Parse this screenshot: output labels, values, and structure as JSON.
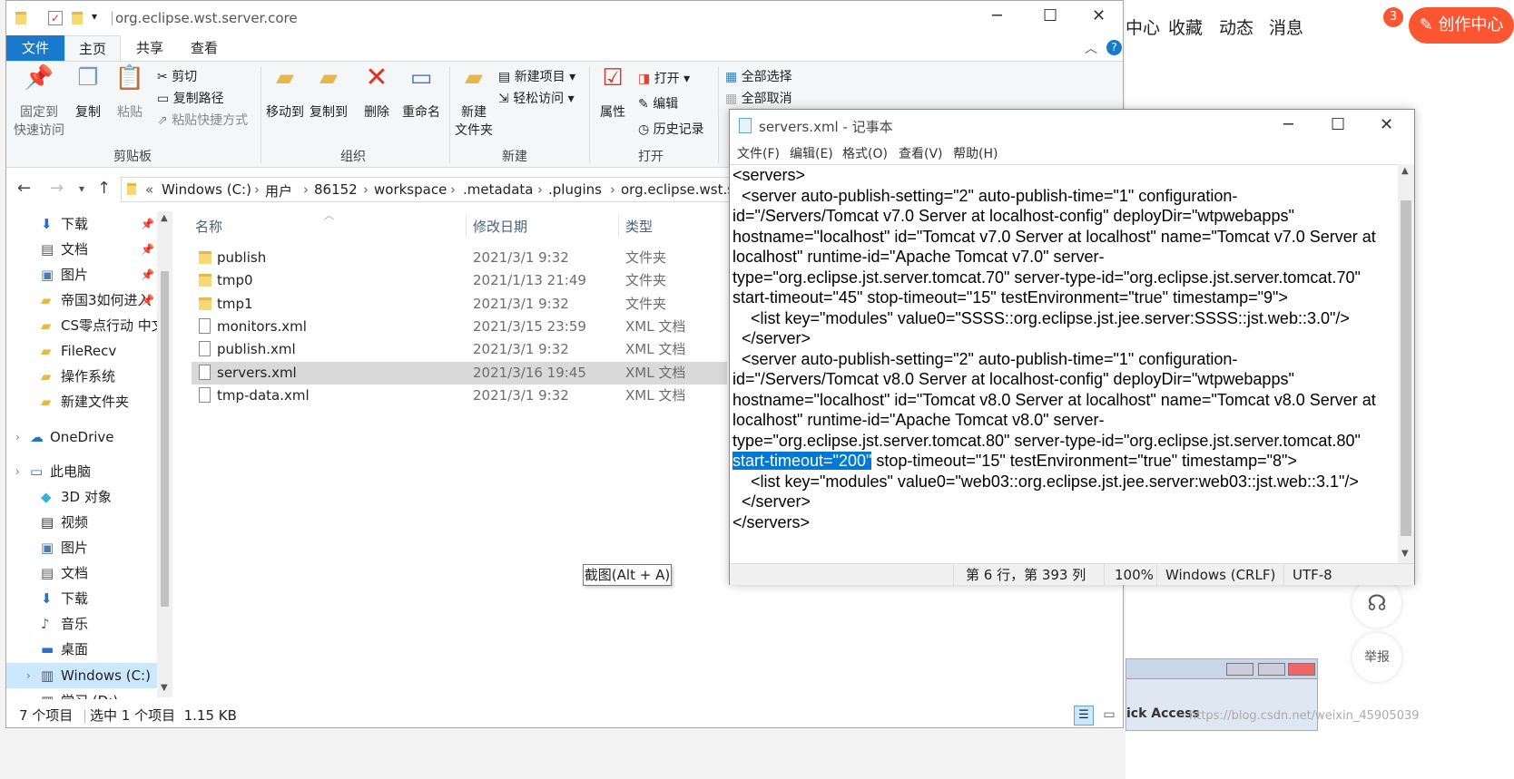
{
  "web": {
    "nav_links": [
      "中心",
      "收藏",
      "动态",
      "消息"
    ],
    "badge": "3",
    "create_btn": "创作中心",
    "report": "举报",
    "watermark": "https://blog.csdn.net/weixin_45905039",
    "access_text": "ick Access"
  },
  "explorer": {
    "title": "org.eclipse.wst.server.core",
    "tabs": [
      "文件",
      "主页",
      "共享",
      "查看"
    ],
    "ribbon": {
      "pin": "固定到\n快速访问",
      "copy": "复制",
      "paste": "粘贴",
      "cut": "剪切",
      "copy_path": "复制路径",
      "paste_shortcut": "粘贴快捷方式",
      "group_clipboard": "剪贴板",
      "move_to": "移动到",
      "copy_to": "复制到",
      "delete": "删除",
      "rename": "重命名",
      "group_organize": "组织",
      "new_folder": "新建\n文件夹",
      "new_item": "新建项目",
      "easy_access": "轻松访问",
      "group_new": "新建",
      "properties": "属性",
      "open": "打开",
      "edit": "编辑",
      "history": "历史记录",
      "group_open": "打开",
      "select_all": "全部选择",
      "select_none": "全部取消"
    },
    "breadcrumb": [
      "Windows (C:)",
      "用户",
      "86152",
      "workspace",
      ".metadata",
      ".plugins",
      "org.eclipse.wst.se"
    ],
    "nav": [
      {
        "label": "下载",
        "icon": "download-icon"
      },
      {
        "label": "文档",
        "icon": "document-icon"
      },
      {
        "label": "图片",
        "icon": "picture-icon"
      },
      {
        "label": "帝国3如何进入",
        "icon": "folder-icon"
      },
      {
        "label": "CS零点行动 中文",
        "icon": "folder-icon"
      },
      {
        "label": "FileRecv",
        "icon": "folder-icon"
      },
      {
        "label": "操作系统",
        "icon": "folder-icon"
      },
      {
        "label": "新建文件夹",
        "icon": "folder-icon"
      },
      {
        "label": "OneDrive",
        "icon": "cloud-icon"
      },
      {
        "label": "此电脑",
        "icon": "computer-icon"
      },
      {
        "label": "3D 对象",
        "icon": "cube-icon"
      },
      {
        "label": "视频",
        "icon": "video-icon"
      },
      {
        "label": "图片",
        "icon": "picture-icon"
      },
      {
        "label": "文档",
        "icon": "document-icon"
      },
      {
        "label": "下载",
        "icon": "download-icon"
      },
      {
        "label": "音乐",
        "icon": "music-icon"
      },
      {
        "label": "桌面",
        "icon": "desktop-icon"
      },
      {
        "label": "Windows (C:)",
        "icon": "drive-icon"
      },
      {
        "label": "学习 (D:)",
        "icon": "drive-icon"
      }
    ],
    "columns": [
      "名称",
      "修改日期",
      "类型"
    ],
    "files": [
      {
        "name": "publish",
        "date": "2021/3/1 9:32",
        "type": "文件夹",
        "kind": "folder"
      },
      {
        "name": "tmp0",
        "date": "2021/1/13 21:49",
        "type": "文件夹",
        "kind": "folder"
      },
      {
        "name": "tmp1",
        "date": "2021/3/1 9:32",
        "type": "文件夹",
        "kind": "folder"
      },
      {
        "name": "monitors.xml",
        "date": "2021/3/15 23:59",
        "type": "XML 文档",
        "kind": "file"
      },
      {
        "name": "publish.xml",
        "date": "2021/3/1 9:32",
        "type": "XML 文档",
        "kind": "file"
      },
      {
        "name": "servers.xml",
        "date": "2021/3/16 19:45",
        "type": "XML 文档",
        "kind": "file"
      },
      {
        "name": "tmp-data.xml",
        "date": "2021/3/1 9:32",
        "type": "XML 文档",
        "kind": "file"
      }
    ],
    "selected_index": 5,
    "status": {
      "count": "7 个项目",
      "selected": "选中 1 个项目  1.15 KB"
    },
    "tooltip": "截图(Alt + A)"
  },
  "notepad": {
    "title": "servers.xml - 记事本",
    "menu": [
      "文件(F)",
      "编辑(E)",
      "格式(O)",
      "查看(V)",
      "帮助(H)"
    ],
    "lines": [
      "<servers>",
      "  <server auto-publish-setting=\"2\" auto-publish-time=\"1\" configuration-",
      "id=\"/Servers/Tomcat v7.0 Server at localhost-config\" deployDir=\"wtpwebapps\"",
      "hostname=\"localhost\" id=\"Tomcat v7.0 Server at localhost\" name=\"Tomcat v7.0 Server at",
      "localhost\" runtime-id=\"Apache Tomcat v7.0\" server-",
      "type=\"org.eclipse.jst.server.tomcat.70\" server-type-id=\"org.eclipse.jst.server.tomcat.70\"",
      "start-timeout=\"45\" stop-timeout=\"15\" testEnvironment=\"true\" timestamp=\"9\">",
      "    <list key=\"modules\" value0=\"SSSS::org.eclipse.jst.jee.server:SSSS::jst.web::3.0\"/>",
      "  </server>",
      "  <server auto-publish-setting=\"2\" auto-publish-time=\"1\" configuration-",
      "id=\"/Servers/Tomcat v8.0 Server at localhost-config\" deployDir=\"wtpwebapps\"",
      "hostname=\"localhost\" id=\"Tomcat v8.0 Server at localhost\" name=\"Tomcat v8.0 Server at",
      "localhost\" runtime-id=\"Apache Tomcat v8.0\" server-",
      "type=\"org.eclipse.jst.server.tomcat.80\" server-type-id=\"org.eclipse.jst.server.tomcat.80\"",
      "",
      "    <list key=\"modules\" value0=\"web03::org.eclipse.jst.jee.server:web03::jst.web::3.1\"/>",
      "  </server>",
      "</servers>"
    ],
    "selected_text": "start-timeout=\"200\"",
    "after_selection": " stop-timeout=\"15\" testEnvironment=\"true\" timestamp=\"8\">",
    "status": {
      "position": "第 6 行，第 393 列",
      "zoom": "100%",
      "eol": "Windows (CRLF)",
      "encoding": "UTF-8"
    }
  },
  "colors": {
    "accent": "#0078d7",
    "csdn": "#fc5531",
    "tab_blue": "#1979ca",
    "selected_row": "#cce8ff"
  }
}
